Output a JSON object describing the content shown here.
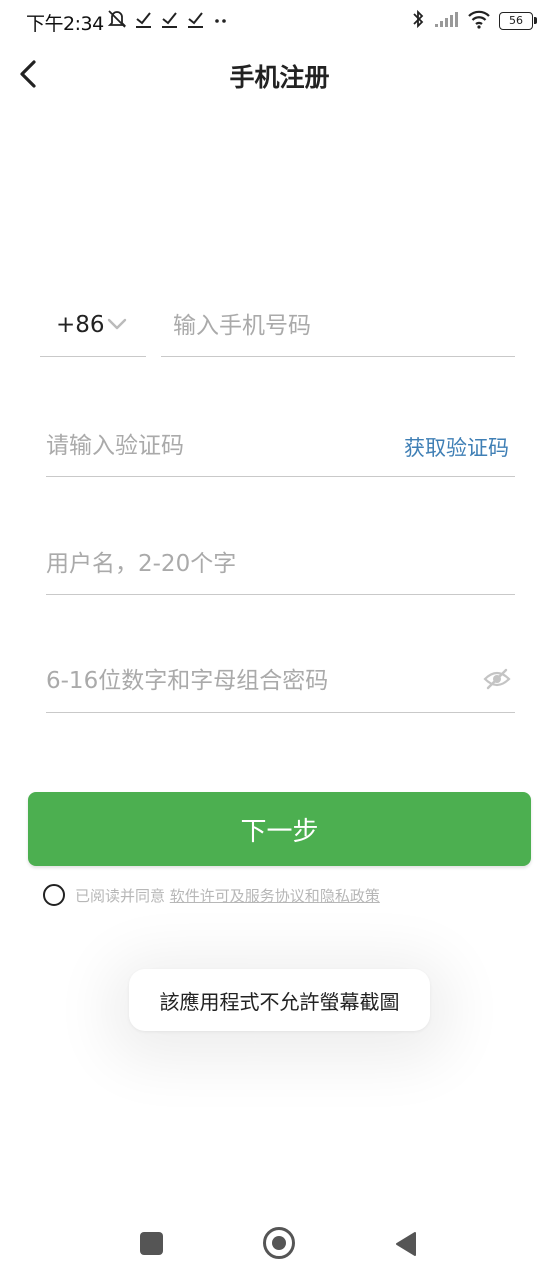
{
  "status_bar": {
    "time": "下午2:34",
    "battery": "56",
    "icons_left": [
      "mute-bell-icon",
      "check-icon",
      "check-icon",
      "check-icon",
      "more-dots-icon"
    ],
    "icons_right": [
      "bluetooth-icon",
      "signal-icon",
      "wifi-icon",
      "battery-icon"
    ]
  },
  "header": {
    "title": "手机注册",
    "back_icon": "chevron-left-icon"
  },
  "form": {
    "country_code": "+86",
    "phone_placeholder": "输入手机号码",
    "code_placeholder": "请输入验证码",
    "get_code_label": "获取验证码",
    "username_placeholder": "用户名，2-20个字",
    "password_placeholder": "6-16位数字和字母组合密码",
    "password_toggle_icon": "eye-off-icon"
  },
  "actions": {
    "next_label": "下一步"
  },
  "agreement": {
    "prefix": "已阅读并同意 ",
    "link1": "软件许可及服务协议",
    "connector": "和",
    "link2": "隐私政策"
  },
  "toast": {
    "message": "該應用程式不允許螢幕截圖"
  },
  "nav_bar": {
    "icons": [
      "recents-square-icon",
      "home-circle-icon",
      "back-triangle-icon"
    ]
  },
  "colors": {
    "primary_green": "#4caf50",
    "link_blue": "#3f7fb5",
    "placeholder_gray": "#aaaaaa"
  }
}
